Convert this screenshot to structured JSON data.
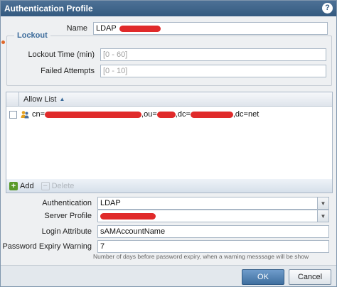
{
  "dialog": {
    "title": "Authentication Profile",
    "help_glyph": "?"
  },
  "name_row": {
    "label": "Name",
    "value": "LDAP"
  },
  "lockout": {
    "legend": "Lockout",
    "lockout_time_label": "Lockout Time (min)",
    "lockout_time_placeholder": "[0 - 60]",
    "failed_attempts_label": "Failed Attempts",
    "failed_attempts_placeholder": "[0 - 10]"
  },
  "allow_list": {
    "header": "Allow List",
    "rows": [
      {
        "parts": [
          "cn=",
          ",ou=",
          ",dc=",
          ",dc=net"
        ]
      }
    ]
  },
  "toolbar": {
    "add_label": "Add",
    "delete_label": "Delete"
  },
  "authentication": {
    "label": "Authentication",
    "value": "LDAP"
  },
  "server_profile": {
    "label": "Server Profile"
  },
  "login_attribute": {
    "label": "Login Attribute",
    "value": "sAMAccountName"
  },
  "password_expiry": {
    "label": "Password Expiry Warning",
    "value": "7",
    "hint": "Number of days before password expiry, when a warning messsage will be show"
  },
  "footer": {
    "ok_label": "OK",
    "cancel_label": "Cancel"
  },
  "colors": {
    "title_bar": "#3f6488",
    "accent": "#3a6a9a",
    "redaction": "#e02a2a",
    "add_icon": "#5a9a2a"
  }
}
